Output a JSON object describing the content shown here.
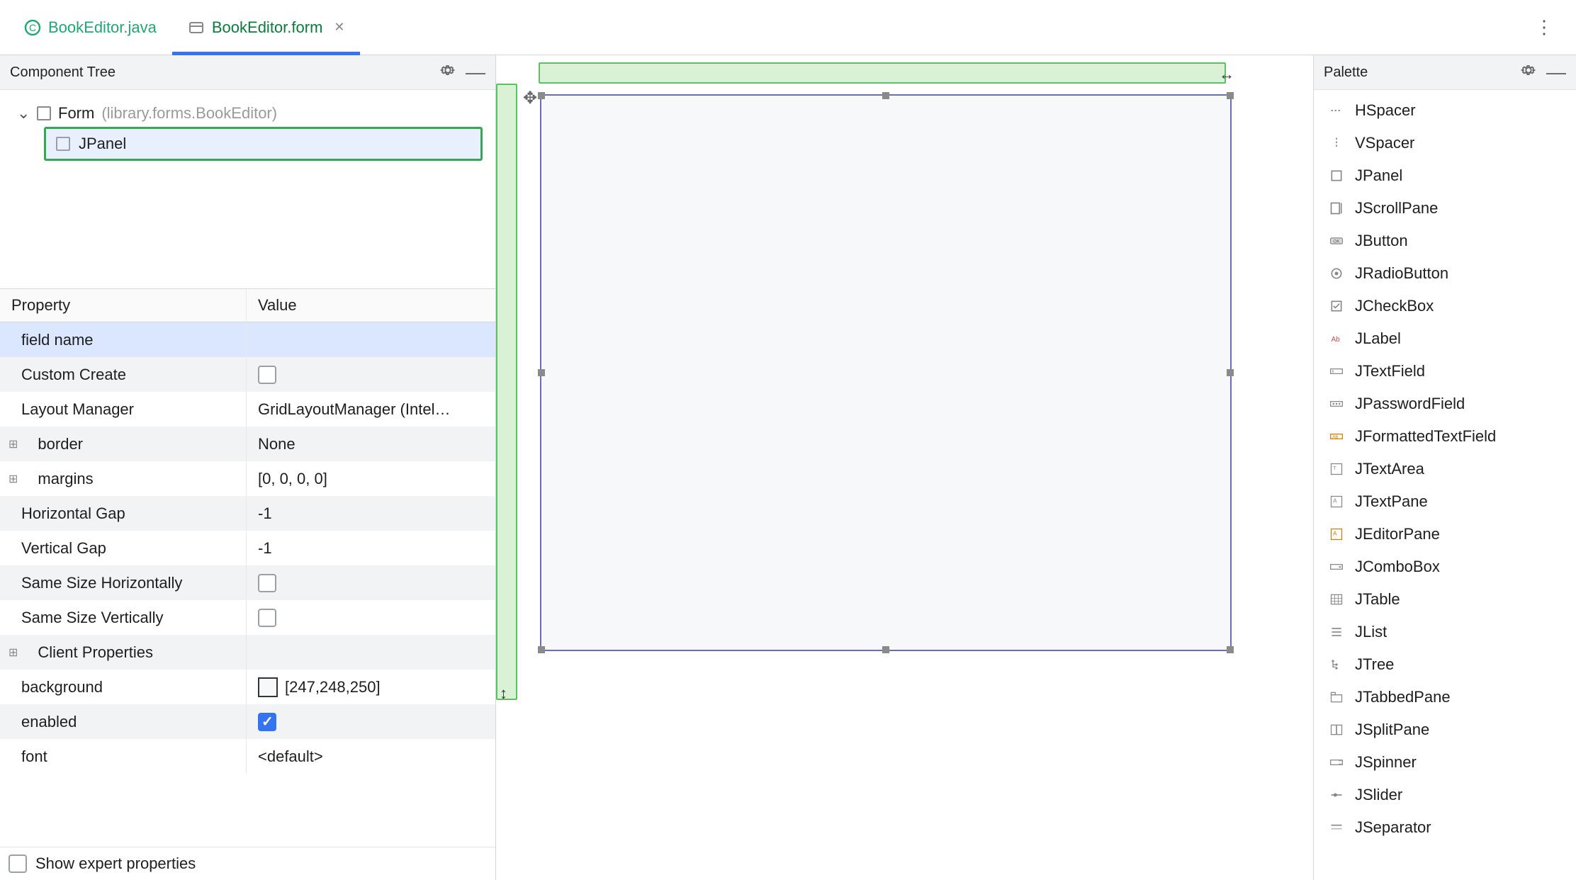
{
  "tabs": {
    "java_tab": "BookEditor.java",
    "form_tab": "BookEditor.form"
  },
  "left": {
    "tree_header": "Component Tree",
    "form_label": "Form",
    "form_qual": "(library.forms.BookEditor)",
    "jpanel_label": "JPanel",
    "prop_header_name": "Property",
    "prop_header_value": "Value",
    "properties": [
      {
        "name": "field name",
        "value": "",
        "type": "text",
        "selected": true
      },
      {
        "name": "Custom Create",
        "value": false,
        "type": "checkbox"
      },
      {
        "name": "Layout Manager",
        "value": "GridLayoutManager (Intel…",
        "type": "text"
      },
      {
        "name": "border",
        "value": "None",
        "type": "text",
        "expandable": true
      },
      {
        "name": "margins",
        "value": "[0, 0, 0, 0]",
        "type": "text",
        "expandable": true
      },
      {
        "name": "Horizontal Gap",
        "value": "-1",
        "type": "text"
      },
      {
        "name": "Vertical Gap",
        "value": "-1",
        "type": "text"
      },
      {
        "name": "Same Size Horizontally",
        "value": false,
        "type": "checkbox"
      },
      {
        "name": "Same Size Vertically",
        "value": false,
        "type": "checkbox"
      },
      {
        "name": "Client Properties",
        "value": "",
        "type": "text",
        "expandable": true
      },
      {
        "name": "background",
        "value": "[247,248,250]",
        "type": "color"
      },
      {
        "name": "enabled",
        "value": true,
        "type": "checkbox"
      },
      {
        "name": "font",
        "value": "<default>",
        "type": "text"
      }
    ],
    "show_expert": "Show expert properties"
  },
  "palette": {
    "header": "Palette",
    "items": [
      "HSpacer",
      "VSpacer",
      "JPanel",
      "JScrollPane",
      "JButton",
      "JRadioButton",
      "JCheckBox",
      "JLabel",
      "JTextField",
      "JPasswordField",
      "JFormattedTextField",
      "JTextArea",
      "JTextPane",
      "JEditorPane",
      "JComboBox",
      "JTable",
      "JList",
      "JTree",
      "JTabbedPane",
      "JSplitPane",
      "JSpinner",
      "JSlider",
      "JSeparator"
    ]
  }
}
